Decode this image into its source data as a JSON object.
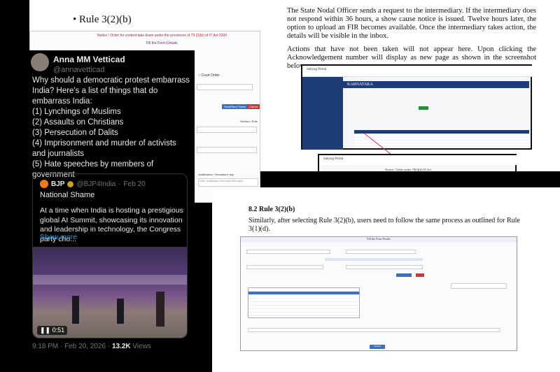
{
  "doc_top_left": {
    "bullet": "Rule 3(2)(b)",
    "form_title": "Notice / Order for content take down under the provisions of 79 (3)(b) of IT Act 2000",
    "form_subtitle": "Fill the Form Details",
    "court_order": "Court Order",
    "submit_button": "Send/Sent Thank",
    "cancel_button": "Cancel",
    "section_label": "Section / Rule",
    "justification_label": "Justification / Remarks if any",
    "justification_placeholder": "Enter Justification Here (max 500 chars)"
  },
  "doc_top_right": {
    "paragraph1": "The State Nodal Officer sends a request to the intermediary. If the intermediary does not respond within 36 hours, a show cause notice is issued. Twelve hours later, the option to upload an FIR becomes available. Once the intermediary takes action, the details will be visible in the inbox.",
    "paragraph2": "Actions that have not been taken will not appear here. Upon clicking the Acknowledgement number will display as new page as shown in the screenshot below:",
    "portal_name": "Sahyog Portal",
    "state": "KARNATAKA",
    "notice_title": "Notice / Order under 79(3)(b) IT Act"
  },
  "doc_bottom_right": {
    "heading": "8.2 Rule 3(2)(b)",
    "paragraph": "Similarly, after selecting Rule 3(2)(b), users need to follow the same process as outlined for Rule 3(1)(d).",
    "form_title": "Fill the Form Details",
    "submit_button": "Submit"
  },
  "tweet": {
    "author_name": "Anna MM Vetticad",
    "author_handle": "@annavetticad",
    "text": "Why should a democratic protest embarrass India? Here's a list of things that do embarrass India:\n(1) Lynchings of Muslims\n(2) Assaults on Christians\n(3) Persecution of Dalits\n(4) Imprisonment and murder of activists and journalists\n(5) Hate speeches by members of government",
    "quote_name": "BJP",
    "quote_handle": "@BJP4India",
    "quote_date": "Feb 20",
    "quote_title": "National Shame",
    "quote_text": "At a time when India is hosting a prestigious global AI Summit, showcasing its innovation and leadership in technology, the Congress party cho...",
    "show_more": "Show more",
    "video_time": "0:51",
    "timestamp": "9:18 PM · Feb 20, 2026 · ",
    "views_count": "13.2K",
    "views_label": " Views"
  }
}
